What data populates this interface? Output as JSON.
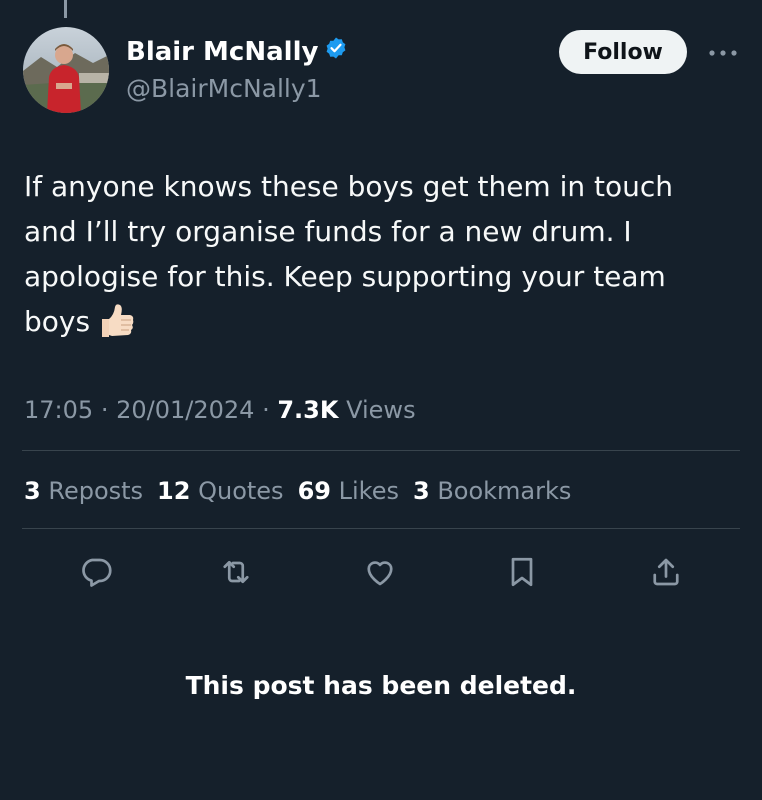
{
  "author": {
    "display_name": "Blair McNally",
    "handle": "@BlairMcNally1",
    "verified": true,
    "verified_color": "#1d9bf0"
  },
  "header": {
    "follow_label": "Follow",
    "more_icon": "more-horizontal-icon"
  },
  "tweet": {
    "text": "If anyone knows these boys get them in touch and I’ll try organise funds for a new drum. I apologise for this. Keep supporting your team boys",
    "emoji": "thumbs-up-light-skin-tone"
  },
  "meta": {
    "time": "17:05",
    "separator": "·",
    "date": "20/01/2024",
    "views_count": "7.3K",
    "views_label": "Views"
  },
  "stats": {
    "reposts_count": "3",
    "reposts_label": "Reposts",
    "quotes_count": "12",
    "quotes_label": "Quotes",
    "likes_count": "69",
    "likes_label": "Likes",
    "bookmarks_count": "3",
    "bookmarks_label": "Bookmarks"
  },
  "actions": [
    "reply-icon",
    "repost-icon",
    "like-icon",
    "bookmark-icon",
    "share-icon"
  ],
  "notice": "This post has been deleted.",
  "colors": {
    "background": "#15202b",
    "secondary_text": "#8b98a5",
    "divider": "#38444d",
    "follow_bg": "#eff3f4"
  }
}
